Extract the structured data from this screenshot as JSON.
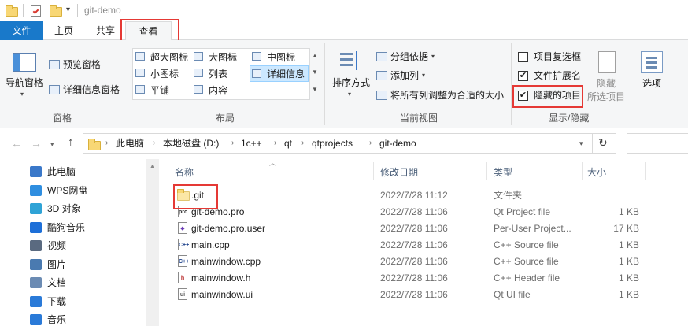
{
  "window": {
    "title": "git-demo"
  },
  "tabs": {
    "file": "文件",
    "home": "主页",
    "share": "共享",
    "view": "查看"
  },
  "ribbon": {
    "panes": {
      "nav_pane": "导航窗格",
      "preview_pane": "预览窗格",
      "details_pane": "详细信息窗格",
      "group": "窗格"
    },
    "layout": {
      "xl_icons": "超大图标",
      "l_icons": "大图标",
      "m_icons": "中图标",
      "s_icons": "小图标",
      "list": "列表",
      "details": "详细信息",
      "tiles": "平铺",
      "content": "内容",
      "group": "布局"
    },
    "current_view": {
      "sort_by": "排序方式",
      "group_by": "分组依据",
      "add_columns": "添加列",
      "fit_columns": "将所有列调整为合适的大小",
      "group": "当前视图"
    },
    "show_hide": {
      "item_checkboxes": "项目复选框",
      "file_extensions": "文件扩展名",
      "hidden_items": "隐藏的项目",
      "hide_selected_1": "隐藏",
      "hide_selected_2": "所选项目",
      "options": "选项",
      "group": "显示/隐藏",
      "item_checkboxes_checked": false,
      "file_extensions_checked": true,
      "hidden_items_checked": true
    }
  },
  "address": {
    "crumbs": [
      "此电脑",
      "本地磁盘 (D:)",
      "1c++",
      "qt",
      "qtprojects",
      "git-demo"
    ]
  },
  "nav": [
    {
      "label": "此电脑",
      "icon": "computer-icon"
    },
    {
      "label": "WPS网盘",
      "icon": "cloud-icon"
    },
    {
      "label": "3D 对象",
      "icon": "cube-icon"
    },
    {
      "label": "酷狗音乐",
      "icon": "kugou-icon"
    },
    {
      "label": "视频",
      "icon": "video-icon"
    },
    {
      "label": "图片",
      "icon": "picture-icon"
    },
    {
      "label": "文档",
      "icon": "document-icon"
    },
    {
      "label": "下载",
      "icon": "download-icon"
    },
    {
      "label": "音乐",
      "icon": "music-icon"
    }
  ],
  "columns": {
    "name": "名称",
    "date": "修改日期",
    "type": "类型",
    "size": "大小"
  },
  "files": [
    {
      "name": ".git",
      "date": "2022/7/28 11:12",
      "type": "文件夹",
      "size": "",
      "icon": "folder-icon"
    },
    {
      "name": "git-demo.pro",
      "date": "2022/7/28 11:06",
      "type": "Qt Project file",
      "size": "1 KB",
      "icon": "pro-file-icon"
    },
    {
      "name": "git-demo.pro.user",
      "date": "2022/7/28 11:06",
      "type": "Per-User Project...",
      "size": "17 KB",
      "icon": "user-file-icon"
    },
    {
      "name": "main.cpp",
      "date": "2022/7/28 11:06",
      "type": "C++ Source file",
      "size": "1 KB",
      "icon": "cpp-file-icon"
    },
    {
      "name": "mainwindow.cpp",
      "date": "2022/7/28 11:06",
      "type": "C++ Source file",
      "size": "1 KB",
      "icon": "cpp-file-icon"
    },
    {
      "name": "mainwindow.h",
      "date": "2022/7/28 11:06",
      "type": "C++ Header file",
      "size": "1 KB",
      "icon": "header-file-icon"
    },
    {
      "name": "mainwindow.ui",
      "date": "2022/7/28 11:06",
      "type": "Qt UI file",
      "size": "1 KB",
      "icon": "ui-file-icon"
    }
  ],
  "colors": {
    "accent": "#1979ca",
    "highlight_box": "#e53935",
    "folder": "#f8d775"
  }
}
